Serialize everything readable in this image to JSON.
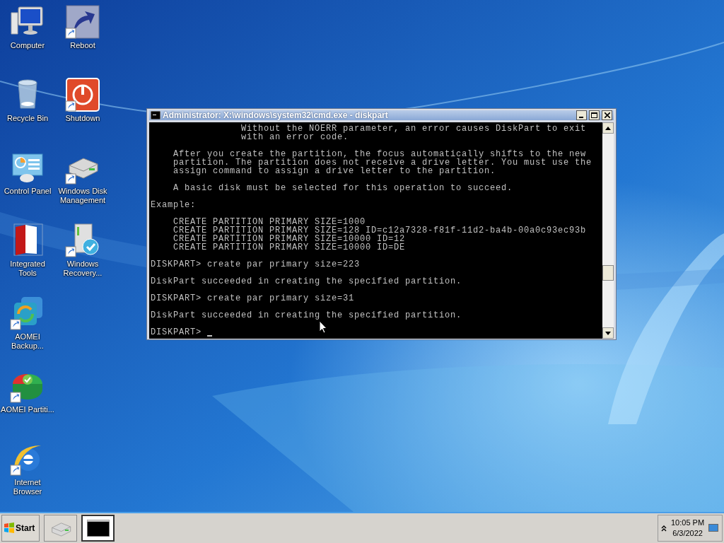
{
  "desktop_columns": [
    [
      {
        "kind": "computer",
        "label": "Computer",
        "shortcut": false
      },
      {
        "kind": "recycle",
        "label": "Recycle Bin",
        "shortcut": false
      },
      {
        "kind": "control",
        "label": "Control Panel",
        "shortcut": false
      },
      {
        "kind": "filezilla",
        "label": "Integrated Tools",
        "shortcut": false
      },
      {
        "kind": "backup",
        "label": "AOMEI Backup...",
        "shortcut": true
      },
      {
        "kind": "partition",
        "label": "AOMEI Partiti...",
        "shortcut": true
      },
      {
        "kind": "browser",
        "label": "Internet Browser",
        "shortcut": true
      }
    ],
    [
      {
        "kind": "arrow",
        "label": "Reboot",
        "shortcut": true
      },
      {
        "kind": "power",
        "label": "Shutdown",
        "shortcut": true
      },
      {
        "kind": "drive",
        "label": "Windows Disk Management",
        "shortcut": true
      },
      {
        "kind": "recovery",
        "label": "Windows Recovery...",
        "shortcut": true
      }
    ]
  ],
  "window": {
    "title": "Administrator: X:\\windows\\system32\\cmd.exe - diskpart",
    "active": true,
    "console_blocks": [
      [
        "                Without the NOERR parameter, an error causes DiskPart to exit",
        "                with an error code."
      ],
      [
        "    After you create the partition, the focus automatically shifts to the new",
        "    partition. The partition does not receive a drive letter. You must use the",
        "    assign command to assign a drive letter to the partition."
      ],
      [
        "    A basic disk must be selected for this operation to succeed."
      ],
      [
        "Example:"
      ],
      [
        "    CREATE PARTITION PRIMARY SIZE=1000",
        "    CREATE PARTITION PRIMARY SIZE=128 ID=c12a7328-f81f-11d2-ba4b-00a0c93ec93b",
        "    CREATE PARTITION PRIMARY SIZE=10000 ID=12",
        "    CREATE PARTITION PRIMARY SIZE=10000 ID=DE"
      ],
      [
        "DISKPART> create par primary size=223"
      ],
      [
        "DiskPart succeeded in creating the specified partition."
      ],
      [
        "DISKPART> create par primary size=31"
      ],
      [
        "DiskPart succeeded in creating the specified partition."
      ]
    ],
    "prompt": "DISKPART>"
  },
  "taskbar": {
    "start": "Start",
    "buttons": [
      {
        "kind": "drive",
        "selected": false
      },
      {
        "kind": "console",
        "selected": true
      }
    ],
    "clock": {
      "time": "10:05 PM",
      "date": "6/3/2022"
    }
  }
}
